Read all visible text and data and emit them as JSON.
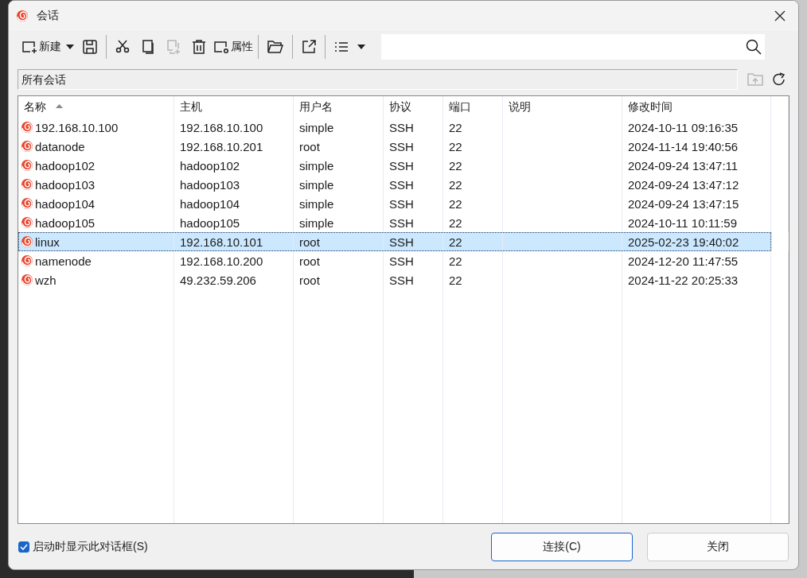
{
  "window": {
    "title": "会话"
  },
  "toolbar": {
    "new_label": "新建",
    "properties_label": "属性",
    "duplicate_disabled": true
  },
  "path_bar": {
    "path": "所有会话",
    "up_disabled": true
  },
  "table": {
    "columns": [
      {
        "label": "名称",
        "sorted": true
      },
      {
        "label": "主机",
        "sorted": false
      },
      {
        "label": "用户名",
        "sorted": false
      },
      {
        "label": "协议",
        "sorted": false
      },
      {
        "label": "端口",
        "sorted": false
      },
      {
        "label": "说明",
        "sorted": false
      },
      {
        "label": "修改时间",
        "sorted": false
      }
    ],
    "rows": [
      {
        "name": "192.168.10.100",
        "host": "192.168.10.100",
        "user": "simple",
        "protocol": "SSH",
        "port": "22",
        "time": "2024-10-11 09:16:35",
        "selected": false
      },
      {
        "name": "datanode",
        "host": "192.168.10.201",
        "user": "root",
        "protocol": "SSH",
        "port": "22",
        "time": "2024-11-14 19:40:56",
        "selected": false
      },
      {
        "name": "hadoop102",
        "host": "hadoop102",
        "user": "simple",
        "protocol": "SSH",
        "port": "22",
        "time": "2024-09-24 13:47:11",
        "selected": false
      },
      {
        "name": "hadoop103",
        "host": "hadoop103",
        "user": "simple",
        "protocol": "SSH",
        "port": "22",
        "time": "2024-09-24 13:47:12",
        "selected": false
      },
      {
        "name": "hadoop104",
        "host": "hadoop104",
        "user": "simple",
        "protocol": "SSH",
        "port": "22",
        "time": "2024-09-24 13:47:15",
        "selected": false
      },
      {
        "name": "hadoop105",
        "host": "hadoop105",
        "user": "simple",
        "protocol": "SSH",
        "port": "22",
        "time": "2024-10-11 10:11:59",
        "selected": false
      },
      {
        "name": "linux",
        "host": "192.168.10.101",
        "user": "root",
        "protocol": "SSH",
        "port": "22",
        "time": "2025-02-23 19:40:02",
        "selected": true
      },
      {
        "name": "namenode",
        "host": "192.168.10.200",
        "user": "root",
        "protocol": "SSH",
        "port": "22",
        "time": "2024-12-20 11:47:55",
        "selected": false
      },
      {
        "name": "wzh",
        "host": "49.232.59.206",
        "user": "root",
        "protocol": "SSH",
        "port": "22",
        "time": "2024-11-22 20:25:33",
        "selected": false
      }
    ]
  },
  "startup_checkbox": {
    "label": "启动时显示此对话框(S)",
    "checked": true
  },
  "buttons": [
    {
      "label": "连接(C)",
      "default": true
    },
    {
      "label": "关闭",
      "default": false
    }
  ]
}
